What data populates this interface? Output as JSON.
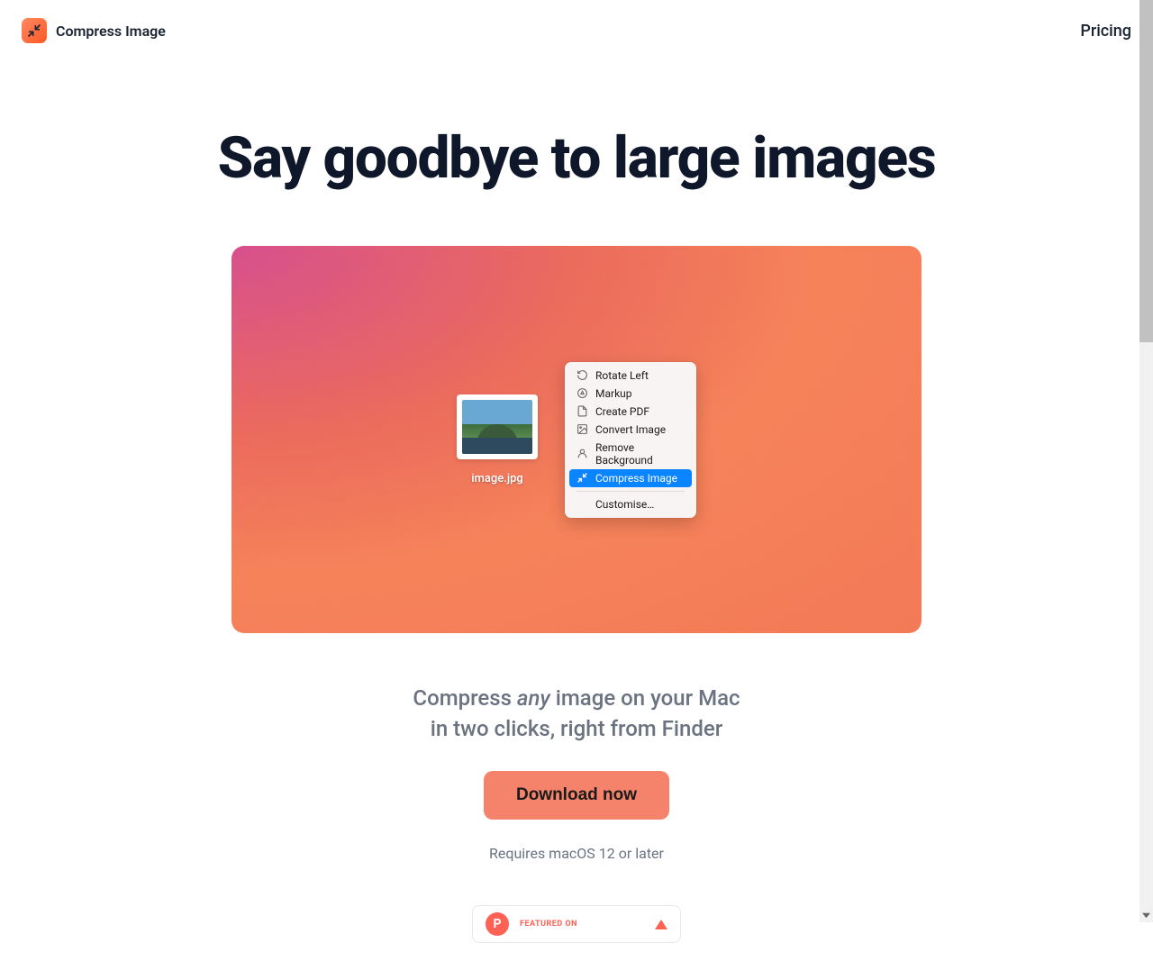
{
  "header": {
    "brand": "Compress Image",
    "nav": {
      "pricing": "Pricing"
    }
  },
  "hero": {
    "title": "Say goodbye to large images",
    "file_label": "image.jpg",
    "menu": {
      "items": [
        "Rotate Left",
        "Markup",
        "Create PDF",
        "Convert Image",
        "Remove Background",
        "Compress Image"
      ],
      "customise": "Customise…"
    },
    "subtitle_prefix": "Compress ",
    "subtitle_em": "any",
    "subtitle_suffix": " image on your Mac",
    "subtitle_line2": "in two clicks, right from Finder"
  },
  "cta": {
    "download": "Download now",
    "requirement": "Requires macOS 12 or later"
  },
  "featured": {
    "label": "FEATURED ON",
    "ph_initial": "P"
  }
}
